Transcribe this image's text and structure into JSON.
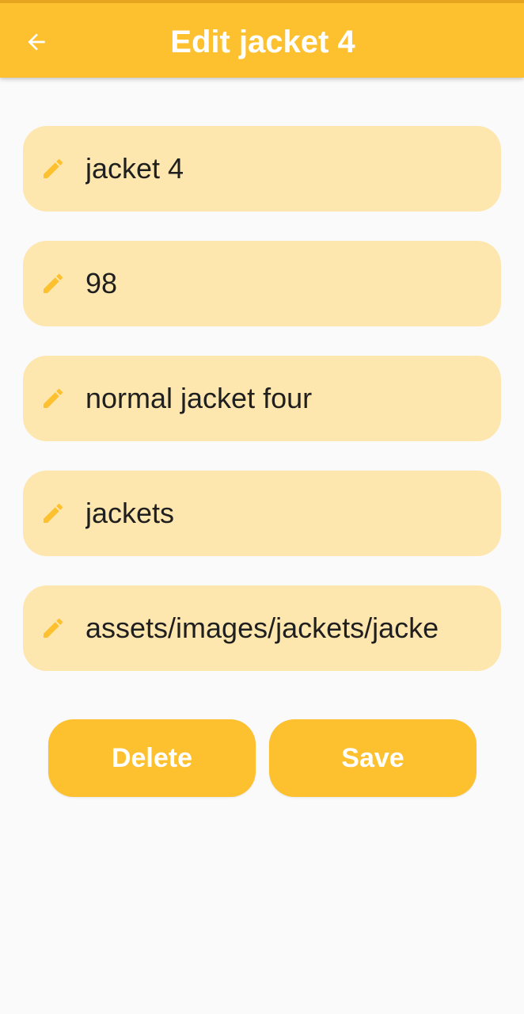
{
  "app_bar": {
    "title": "Edit jacket 4",
    "back_icon": "arrow-left-icon"
  },
  "form": {
    "fields": [
      {
        "name": "name",
        "value": "jacket 4",
        "icon": "pencil-icon"
      },
      {
        "name": "price",
        "value": "98",
        "icon": "pencil-icon"
      },
      {
        "name": "description",
        "value": "normal jacket four",
        "icon": "pencil-icon"
      },
      {
        "name": "category",
        "value": "jackets",
        "icon": "pencil-icon"
      },
      {
        "name": "image-path",
        "value": "assets/images/jackets/jacke",
        "icon": "pencil-icon"
      }
    ]
  },
  "actions": {
    "delete_label": "Delete",
    "save_label": "Save"
  },
  "colors": {
    "primary": "#fdc02f",
    "field_fill": "#fee7ae",
    "background": "#fafafa",
    "text": "#1f1f1f",
    "on_primary": "#ffffff"
  }
}
